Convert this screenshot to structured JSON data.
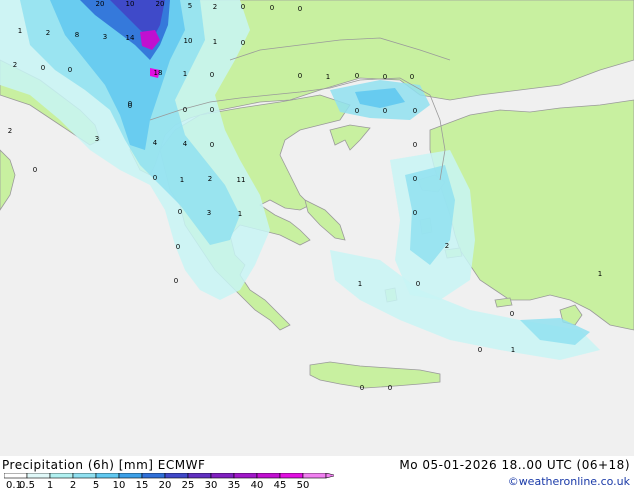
{
  "map": {
    "colors": {
      "sea": "#f0f0f0",
      "land": "#c8f0a0",
      "coast": "#9a9a9a",
      "border": "#9a9a9a"
    },
    "labels": [
      "20",
      "10",
      "20",
      "5",
      "2",
      "0",
      "0",
      "0",
      "1",
      "2",
      "8",
      "3",
      "14",
      "10",
      "1",
      "0",
      "2",
      "0",
      "0",
      "18",
      "1",
      "0",
      "0",
      "1",
      "0",
      "0",
      "0",
      "0",
      "0",
      "0",
      "0",
      "0",
      "0",
      "3",
      "0",
      "2",
      "0",
      "4",
      "4",
      "0",
      "0",
      "2",
      "11",
      "1",
      "3",
      "1",
      "0",
      "0",
      "0",
      "2",
      "0",
      "0",
      "0",
      "1",
      "0",
      "1",
      "0",
      "0",
      "1",
      "0",
      "0"
    ]
  },
  "legend": {
    "title": "Precipitation (6h) [mm] ECMWF",
    "datetime": "Mo 05-01-2026 18..00 UTC (06+18)",
    "credit": "©weatheronline.co.uk",
    "ticks": [
      "0.1",
      "0.5",
      "1",
      "2",
      "5",
      "10",
      "15",
      "20",
      "25",
      "30",
      "35",
      "40",
      "45",
      "50"
    ],
    "colors": [
      "#ffffff",
      "#e0f8f8",
      "#b0f0f0",
      "#90e0f0",
      "#60c8f0",
      "#3ca0e8",
      "#3070d8",
      "#4048c8",
      "#6030c0",
      "#8020c0",
      "#a018c8",
      "#c010d0",
      "#e010e0",
      "#f080f0"
    ]
  }
}
